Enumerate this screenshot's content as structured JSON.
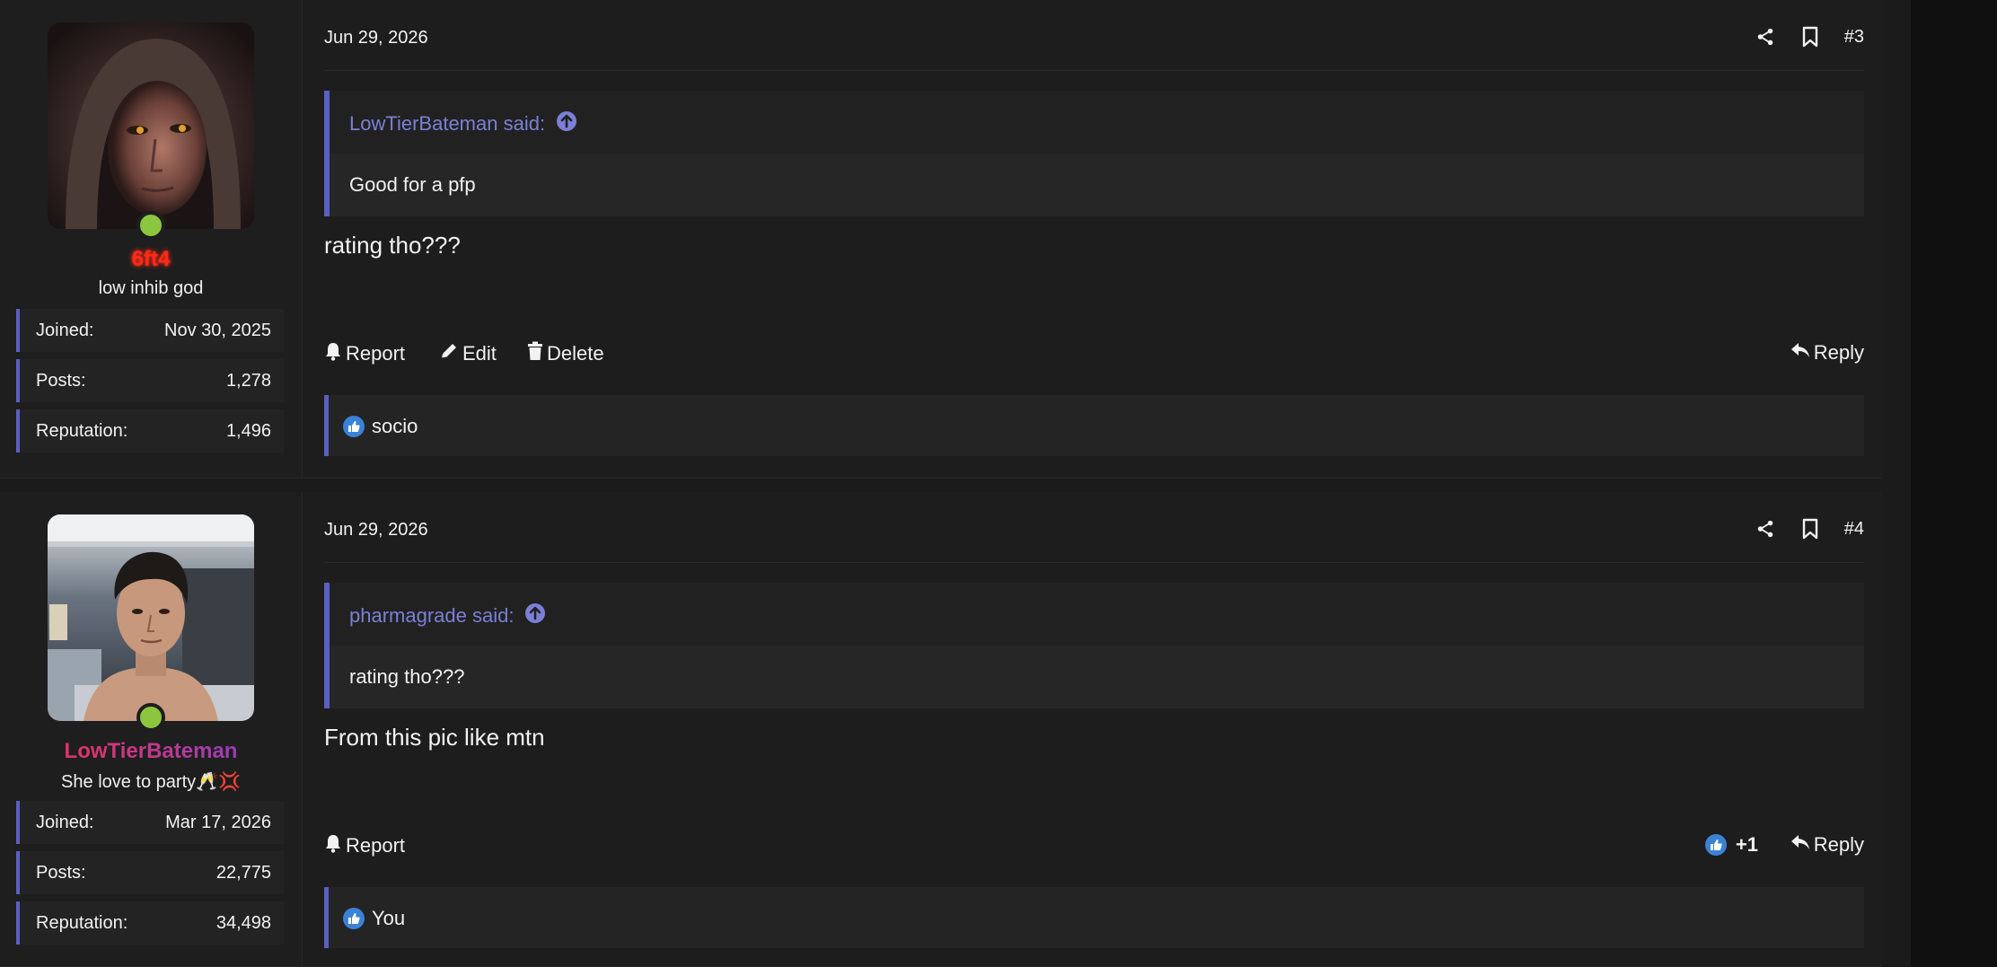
{
  "colors": {
    "accent": "#5a5fc4",
    "quote_attribution": "#7b80d6",
    "online": "#8cc63f",
    "like": "#3b82d6",
    "username_red": "#ff2a1a"
  },
  "posts": [
    {
      "user": {
        "avatar_icon": "hooded-figure-avatar",
        "username": "6ft4",
        "title": "low inhib god",
        "stats": [
          {
            "label": "Joined:",
            "value": "Nov 30, 2025"
          },
          {
            "label": "Posts:",
            "value": "1,278"
          },
          {
            "label": "Reputation:",
            "value": "1,496"
          }
        ]
      },
      "date": "Jun 29, 2026",
      "number": "#3",
      "quote": {
        "attribution": "LowTierBateman said:",
        "text": "Good for a pfp"
      },
      "message": "rating tho???",
      "actions": {
        "report": "Report",
        "edit": "Edit",
        "delete": "Delete",
        "reply": "Reply"
      },
      "reactions": {
        "icon": "thumbs-up-icon",
        "text": "socio"
      }
    },
    {
      "user": {
        "avatar_icon": "selfie-man-avatar",
        "username": "LowTierBateman",
        "title": "She love to party🥂💢",
        "stats": [
          {
            "label": "Joined:",
            "value": "Mar 17, 2026"
          },
          {
            "label": "Posts:",
            "value": "22,775"
          },
          {
            "label": "Reputation:",
            "value": "34,498"
          }
        ]
      },
      "date": "Jun 29, 2026",
      "number": "#4",
      "quote": {
        "attribution": "pharmagrade said:",
        "text": "rating tho???"
      },
      "message": "From this pic like mtn",
      "actions": {
        "report": "Report",
        "like_count": "+1",
        "reply": "Reply"
      },
      "reactions": {
        "icon": "thumbs-up-icon",
        "text": "You"
      }
    }
  ]
}
